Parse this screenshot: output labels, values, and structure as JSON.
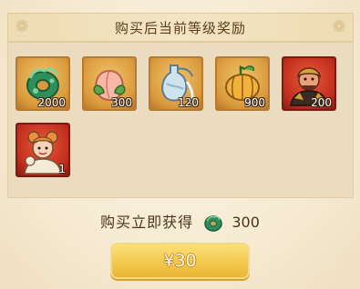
{
  "header": {
    "title": "购买后当前等级奖励"
  },
  "rewards": [
    {
      "icon": "jade-coin-icon",
      "quantity": "2000",
      "frame": "gold"
    },
    {
      "icon": "peach-icon",
      "quantity": "300",
      "frame": "gold"
    },
    {
      "icon": "spirit-vase-icon",
      "quantity": "120",
      "frame": "gold"
    },
    {
      "icon": "golden-pumpkin-icon",
      "quantity": "900",
      "frame": "gold"
    },
    {
      "icon": "hero-portrait-icon",
      "quantity": "200",
      "frame": "red"
    },
    {
      "icon": "child-hero-portrait-icon",
      "quantity": "1",
      "frame": "red"
    }
  ],
  "instant": {
    "label": "购买立即获得",
    "icon": "jade-coin-icon",
    "amount": "300"
  },
  "buy_button": {
    "price": "¥30"
  },
  "colors": {
    "gold_frame": "#d99a3c",
    "red_frame": "#c02d1c",
    "button": "#f3c94e"
  }
}
